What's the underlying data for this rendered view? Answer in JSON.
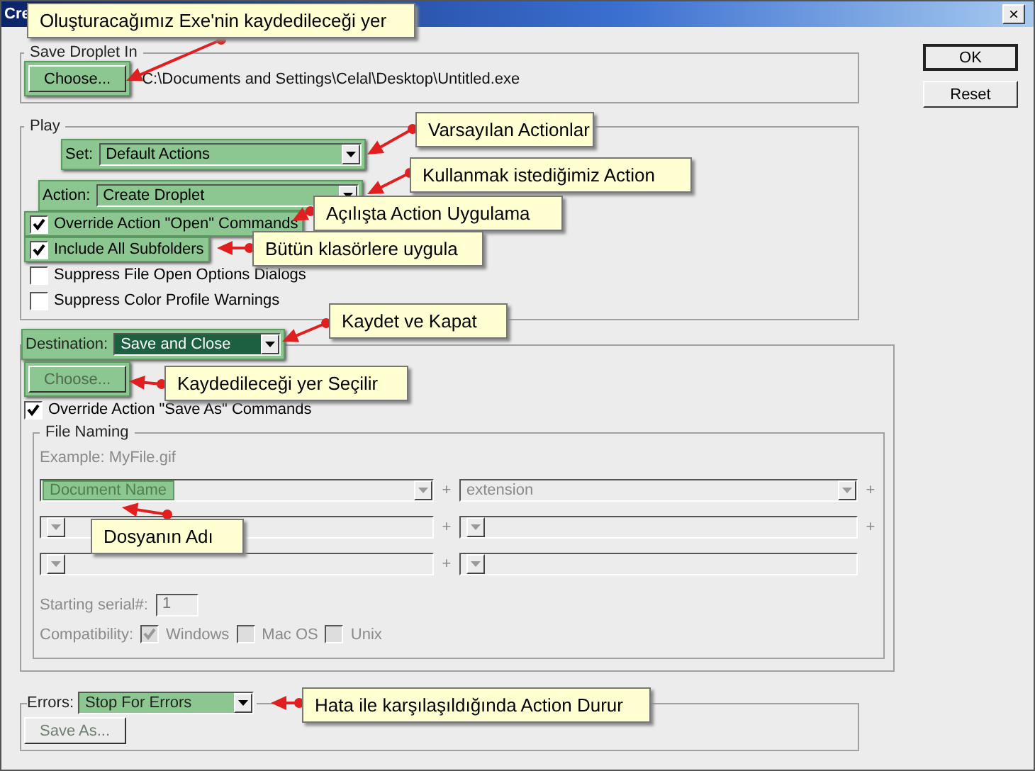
{
  "window": {
    "title": "Cre",
    "close": "×"
  },
  "buttons": [
    {
      "label": "OK",
      "default": true
    },
    {
      "label": "Reset",
      "default": false
    }
  ],
  "save_droplet_in": {
    "legend": "Save Droplet In",
    "choose_button": {
      "label": "Choose...",
      "highlighted": true
    },
    "path": "C:\\Documents and Settings\\Celal\\Desktop\\Untitled.exe"
  },
  "play": {
    "legend": "Play",
    "set": {
      "label": "Set:",
      "value": "Default Actions",
      "highlighted": true
    },
    "action": {
      "label": "Action:",
      "value": "Create Droplet",
      "highlighted": true
    },
    "options": [
      {
        "label": "Override Action \"Open\" Commands",
        "checked": true,
        "highlighted": true
      },
      {
        "label": "Include All Subfolders",
        "checked": true,
        "highlighted": true
      },
      {
        "label": "Suppress File Open Options Dialogs",
        "checked": false,
        "highlighted": false
      },
      {
        "label": "Suppress Color Profile Warnings",
        "checked": false,
        "highlighted": false
      }
    ]
  },
  "destination": {
    "label": "Destination:",
    "value": "Save and Close",
    "highlighted": true,
    "choose_button": {
      "label": "Choose...",
      "disabled": true,
      "highlighted": true
    },
    "override": {
      "label": "Override Action \"Save As\" Commands",
      "checked": true
    },
    "file_naming": {
      "legend": "File Naming",
      "disabled": true,
      "example": "Example: MyFile.gif",
      "rows": [
        {
          "left": "Document Name",
          "left_highlighted": true,
          "right": "extension",
          "trailing_plus": true
        },
        {
          "trailing_plus": true
        },
        {
          "trailing_plus": false
        }
      ],
      "plus": "+",
      "starting_serial": {
        "label": "Starting serial#:",
        "value": "1"
      },
      "compatibility": {
        "label": "Compatibility:",
        "options": [
          {
            "label": "Windows",
            "checked": true
          },
          {
            "label": "Mac OS",
            "checked": false
          },
          {
            "label": "Unix",
            "checked": false
          }
        ]
      }
    }
  },
  "errors": {
    "label": "Errors:",
    "value": "Stop For Errors",
    "highlighted": true,
    "save_as_button": {
      "label": "Save As...",
      "disabled": true
    }
  },
  "callouts": [
    {
      "text": "Oluşturacağımız Exe'nin kaydedileceği yer"
    },
    {
      "text": "Varsayılan Actionlar"
    },
    {
      "text": "Kullanmak istediğimiz Action"
    },
    {
      "text": "Açılışta Action Uygulama"
    },
    {
      "text": "Bütün klasörlere uygula"
    },
    {
      "text": "Kaydet ve Kapat"
    },
    {
      "text": "Kaydedileceği yer Seçilir"
    },
    {
      "text": "Dosyanın Adı"
    },
    {
      "text": "Hata ile karşılaşıldığında Action Durur"
    }
  ]
}
